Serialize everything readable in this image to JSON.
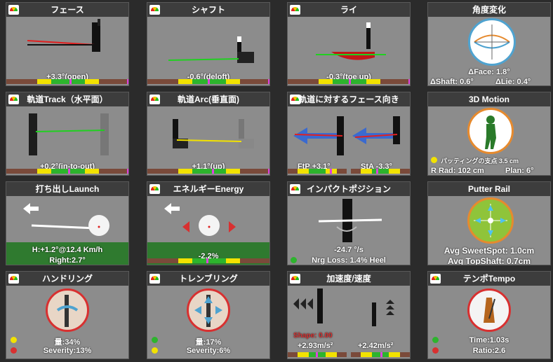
{
  "colors": {
    "tile": "#8c8c8c",
    "header": "#3d3d3d",
    "accent_orange": "#e68a2e",
    "accent_red": "#d83030",
    "good_green": "#2db42d",
    "warn_yellow": "#f2e200",
    "bar_base": "#7a4a3a",
    "marker": "#e040e0"
  },
  "tiles": {
    "face": {
      "title": "フェース",
      "value": "+3.3°(open)"
    },
    "shaft": {
      "title": "シャフト",
      "value": "-0.6°(deloft)"
    },
    "lie": {
      "title": "ライ",
      "value": "-0.3°(toe up)"
    },
    "angle_change": {
      "title": "角度変化",
      "face": "ΔFace: 1.8°",
      "shaft": "ΔShaft: 0.6°",
      "lie": "ΔLie: 0.4°"
    },
    "track": {
      "title": "軌道Track（水平面）",
      "value": "+0.2°(in-to-out)"
    },
    "arc": {
      "title": "軌道Arc(垂直面)",
      "value": "+1.1°(up)"
    },
    "face_to_path": {
      "title": "軌道に対するフェース向き",
      "ftp": "FtP +3.1°",
      "sta": "StA -3.3°"
    },
    "motion3d": {
      "title": "3D Motion",
      "fulcrum": "パッティングの支点 3.5 cm",
      "rrad": "R Rad: 102 cm",
      "plan": "Plan: 6°"
    },
    "launch": {
      "title": "打ち出しLaunch",
      "h": "H:+1.2°@12.4 Km/h",
      "right": "Right:2.7°"
    },
    "energy": {
      "title": "エネルギーEnergy",
      "value": "-2.2%"
    },
    "impact": {
      "title": "インパクトポジション",
      "rate": "-24.7 °/s",
      "nrg": "Nrg Loss: 1.4% Heel"
    },
    "putter_rail": {
      "title": "Putter Rail",
      "sweet": "Avg SweetSpot: 1.0cm",
      "top": "Avg TopShaft: 0.7cm"
    },
    "handling": {
      "title": "ハンドリング",
      "amount": "量:34%",
      "severity": "Severity:13%"
    },
    "tremble": {
      "title": "トレンブリング",
      "amount": "量:17%",
      "severity": "Severity:6%"
    },
    "accel": {
      "title": "加速度/速度",
      "shape": "Shape: 0.00",
      "left": "+2.93m/s²",
      "right": "+2.42m/s²"
    },
    "tempo": {
      "title": "テンポTempo",
      "time": "Time:1.03s",
      "ratio": "Ratio:2.6"
    }
  }
}
